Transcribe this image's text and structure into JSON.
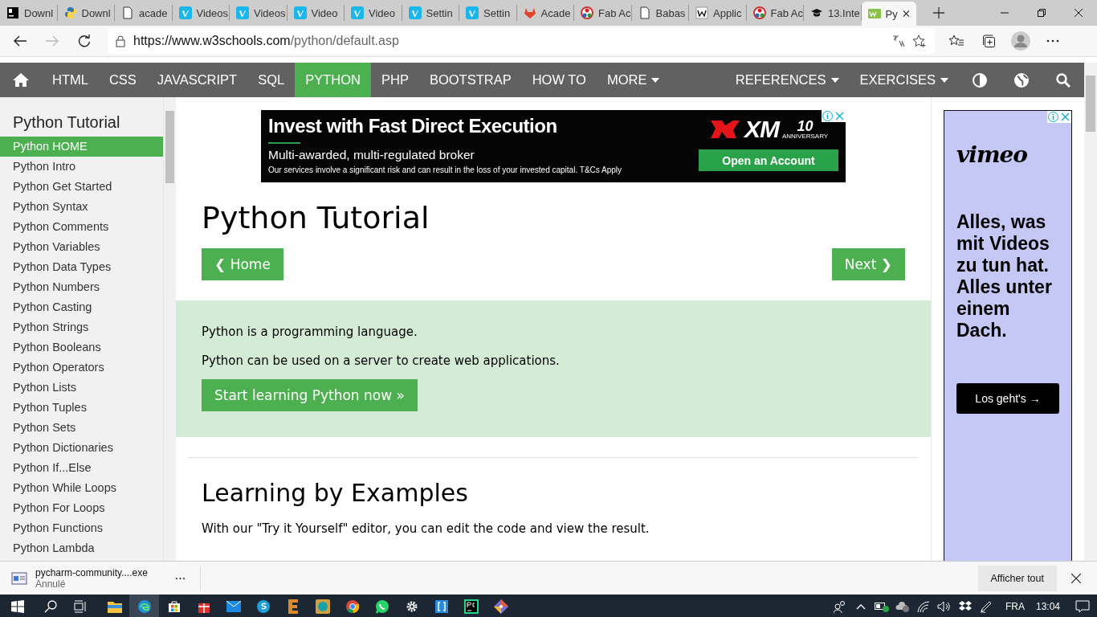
{
  "browser": {
    "tabs": [
      {
        "label": "Downl",
        "kind": "jb",
        "selected": false
      },
      {
        "label": "Downl",
        "kind": "python",
        "selected": false
      },
      {
        "label": "acade",
        "kind": "page",
        "selected": false
      },
      {
        "label": "Videos",
        "kind": "vimeo",
        "selected": false
      },
      {
        "label": "Videos",
        "kind": "vimeo",
        "selected": false
      },
      {
        "label": "Video",
        "kind": "vimeo",
        "selected": false
      },
      {
        "label": "Video",
        "kind": "vimeo",
        "selected": false
      },
      {
        "label": "Settin",
        "kind": "vimeo",
        "selected": false
      },
      {
        "label": "Settin",
        "kind": "vimeo",
        "selected": false
      },
      {
        "label": "Acade",
        "kind": "gitlab",
        "selected": false
      },
      {
        "label": "Fab Ac",
        "kind": "fablab",
        "selected": false
      },
      {
        "label": "Babas",
        "kind": "page",
        "selected": false
      },
      {
        "label": "Applic",
        "kind": "wiki",
        "selected": false
      },
      {
        "label": "Fab Ac",
        "kind": "fablab",
        "selected": false
      },
      {
        "label": "13.Inte",
        "kind": "cap",
        "selected": false
      },
      {
        "label": "Py",
        "kind": "w3",
        "selected": true
      }
    ],
    "url_host": "https://www.w3schools.com",
    "url_path": "/python/default.asp"
  },
  "nav": {
    "items": [
      {
        "label": "HTML",
        "selected": false,
        "dropdown": false
      },
      {
        "label": "CSS",
        "selected": false,
        "dropdown": false
      },
      {
        "label": "JAVASCRIPT",
        "selected": false,
        "dropdown": false
      },
      {
        "label": "SQL",
        "selected": false,
        "dropdown": false
      },
      {
        "label": "PYTHON",
        "selected": true,
        "dropdown": false
      },
      {
        "label": "PHP",
        "selected": false,
        "dropdown": false
      },
      {
        "label": "BOOTSTRAP",
        "selected": false,
        "dropdown": false
      },
      {
        "label": "HOW TO",
        "selected": false,
        "dropdown": false
      },
      {
        "label": "MORE",
        "selected": false,
        "dropdown": true
      }
    ],
    "right_items": [
      {
        "label": "REFERENCES",
        "dropdown": true
      },
      {
        "label": "EXERCISES",
        "dropdown": true
      }
    ]
  },
  "sidebar": {
    "heading": "Python Tutorial",
    "items": [
      {
        "label": "Python HOME",
        "selected": true
      },
      {
        "label": "Python Intro",
        "selected": false
      },
      {
        "label": "Python Get Started",
        "selected": false
      },
      {
        "label": "Python Syntax",
        "selected": false
      },
      {
        "label": "Python Comments",
        "selected": false
      },
      {
        "label": "Python Variables",
        "selected": false
      },
      {
        "label": "Python Data Types",
        "selected": false
      },
      {
        "label": "Python Numbers",
        "selected": false
      },
      {
        "label": "Python Casting",
        "selected": false
      },
      {
        "label": "Python Strings",
        "selected": false
      },
      {
        "label": "Python Booleans",
        "selected": false
      },
      {
        "label": "Python Operators",
        "selected": false
      },
      {
        "label": "Python Lists",
        "selected": false
      },
      {
        "label": "Python Tuples",
        "selected": false
      },
      {
        "label": "Python Sets",
        "selected": false
      },
      {
        "label": "Python Dictionaries",
        "selected": false
      },
      {
        "label": "Python If...Else",
        "selected": false
      },
      {
        "label": "Python While Loops",
        "selected": false
      },
      {
        "label": "Python For Loops",
        "selected": false
      },
      {
        "label": "Python Functions",
        "selected": false
      },
      {
        "label": "Python Lambda",
        "selected": false
      }
    ]
  },
  "ad_banner": {
    "headline": "Invest with Fast Direct Execution",
    "subline": "Multi-awarded, multi-regulated broker",
    "disclaimer": "Our services involve a significant risk and can result in the loss of your invested capital. T&Cs Apply",
    "logo": "XM",
    "badge_number": "10",
    "badge_text": "ANNIVERSARY",
    "button": "Open an Account"
  },
  "main": {
    "title": "Python Tutorial",
    "prev_button": "❮ Home",
    "next_button": "Next ❯",
    "intro": [
      "Python is a programming language.",
      "Python can be used on a server to create web applications."
    ],
    "start_button": "Start learning Python now »",
    "section_heading": "Learning by Examples",
    "section_text": "With our \"Try it Yourself\" editor, you can edit the code and view the result."
  },
  "side_ad": {
    "logo": "vimeo",
    "text": "Alles, was mit Videos zu tun hat. Alles unter einem Dach.",
    "button": "Los geht's →"
  },
  "download_bar": {
    "filename": "pycharm-community....exe",
    "status": "Annulé",
    "more": "...",
    "show_all": "Afficher tout"
  },
  "taskbar": {
    "language": "FRA",
    "time": "13:04"
  }
}
